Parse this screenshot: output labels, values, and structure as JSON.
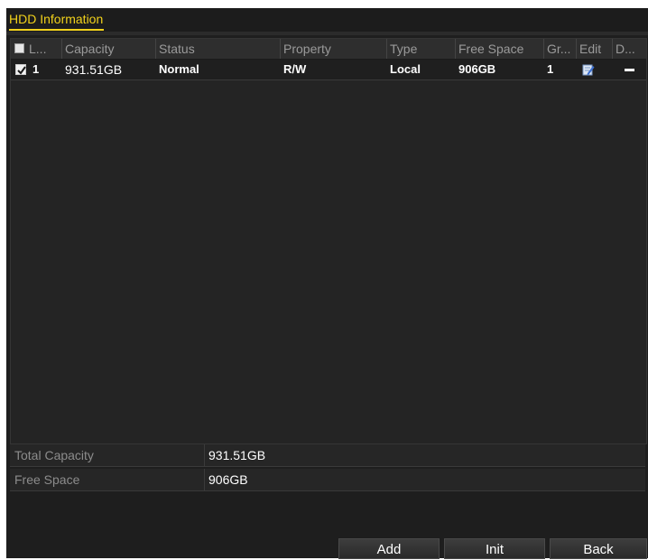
{
  "title_tab": "HDD Information",
  "table": {
    "headers": {
      "label": "L...",
      "capacity": "Capacity",
      "status": "Status",
      "property": "Property",
      "type": "Type",
      "free_space": "Free Space",
      "group": "Gr...",
      "edit": "Edit",
      "delete": "D..."
    },
    "rows": [
      {
        "checked": true,
        "label": "1",
        "capacity": "931.51GB",
        "status": "Normal",
        "property": "R/W",
        "type": "Local",
        "free_space": "906GB",
        "group": "1",
        "edit_icon": "edit-icon",
        "delete_icon": "minus-icon"
      }
    ]
  },
  "summary": {
    "total_capacity_label": "Total Capacity",
    "total_capacity_value": "931.51GB",
    "free_space_label": "Free Space",
    "free_space_value": "906GB"
  },
  "buttons": {
    "add": "Add",
    "init": "Init",
    "back": "Back"
  },
  "colors": {
    "accent": "#f2d21b",
    "background": "#1e1e1e"
  }
}
